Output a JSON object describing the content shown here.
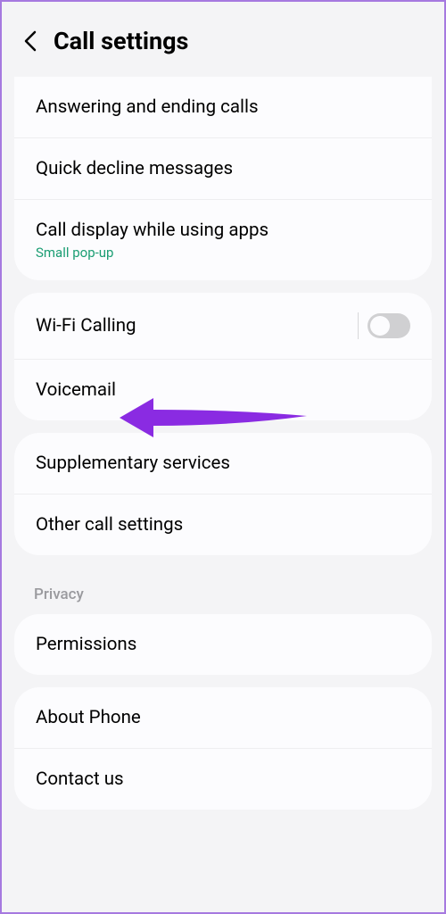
{
  "header": {
    "title": "Call settings"
  },
  "section1": {
    "items": [
      {
        "label": "Answering and ending calls"
      },
      {
        "label": "Quick decline messages"
      },
      {
        "label": "Call display while using apps",
        "sublabel": "Small pop-up"
      }
    ]
  },
  "section2": {
    "items": [
      {
        "label": "Wi-Fi Calling",
        "toggle": false
      },
      {
        "label": "Voicemail"
      }
    ]
  },
  "section3": {
    "items": [
      {
        "label": "Supplementary services"
      },
      {
        "label": "Other call settings"
      }
    ]
  },
  "privacy_header": "Privacy",
  "section4": {
    "items": [
      {
        "label": "Permissions"
      }
    ]
  },
  "section5": {
    "items": [
      {
        "label": "About Phone"
      },
      {
        "label": "Contact us"
      }
    ]
  },
  "arrow_color": "#8a2be2"
}
